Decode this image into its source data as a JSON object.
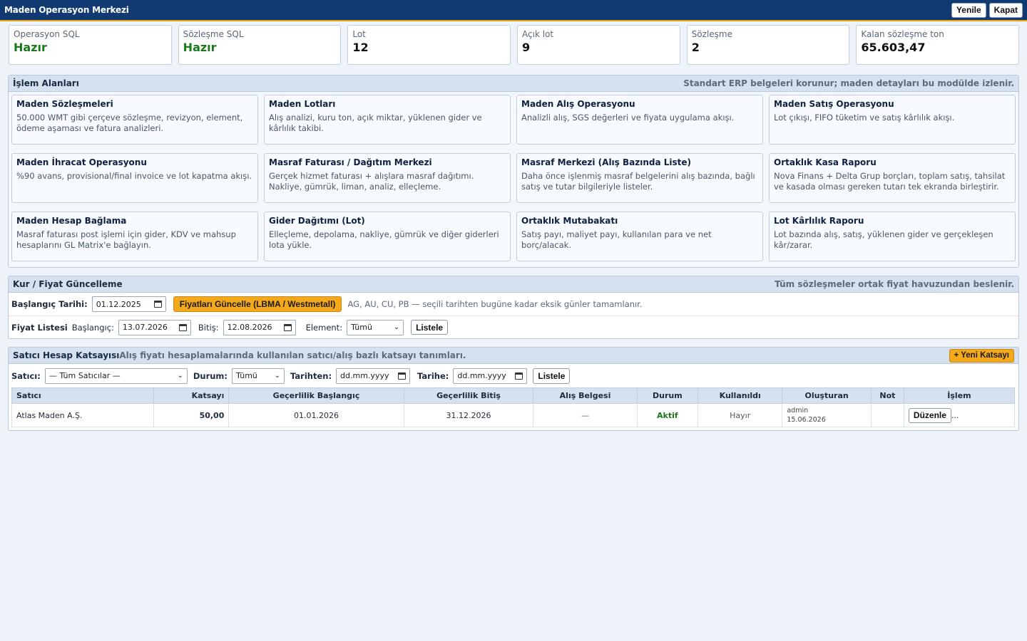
{
  "app": {
    "title": "Maden Operasyon Merkezi",
    "refresh": "Yenile",
    "close": "Kapat"
  },
  "stats": [
    {
      "label": "Operasyon SQL",
      "value": "Hazır",
      "status": "ok"
    },
    {
      "label": "Sözleşme SQL",
      "value": "Hazır",
      "status": "ok"
    },
    {
      "label": "Lot",
      "value": "12"
    },
    {
      "label": "Açık lot",
      "value": "9"
    },
    {
      "label": "Sözleşme",
      "value": "2"
    },
    {
      "label": "Kalan sözleşme ton",
      "value": "65.603,47"
    }
  ],
  "workspace": {
    "title": "İşlem Alanları",
    "note": "Standart ERP belgeleri korunur; maden detayları bu modülde izlenir.",
    "cards": [
      {
        "title": "Maden Sözleşmeleri",
        "desc": "50.000 WMT gibi çerçeve sözleşme, revizyon, element, ödeme aşaması ve fatura analizleri."
      },
      {
        "title": "Maden Lotları",
        "desc": "Alış analizi, kuru ton, açık miktar, yüklenen gider ve kârlılık takibi."
      },
      {
        "title": "Maden Alış Operasyonu",
        "desc": "Analizli alış, SGS değerleri ve fiyata uygulama akışı."
      },
      {
        "title": "Maden Satış Operasyonu",
        "desc": "Lot çıkışı, FIFO tüketim ve satış kârlılık akışı."
      },
      {
        "title": "Maden İhracat Operasyonu",
        "desc": "%90 avans, provisional/final invoice ve lot kapatma akışı."
      },
      {
        "title": "Masraf Faturası / Dağıtım Merkezi",
        "desc": "Gerçek hizmet faturası + alışlara masraf dağıtımı. Nakliye, gümrük, liman, analiz, elleçleme."
      },
      {
        "title": "Masraf Merkezi (Alış Bazında Liste)",
        "desc": "Daha önce işlenmiş masraf belgelerini alış bazında, bağlı satış ve tutar bilgileriyle listeler."
      },
      {
        "title": "Ortaklık Kasa Raporu",
        "desc": "Nova Finans + Delta Grup borçları, toplam satış, tahsilat ve kasada olması gereken tutarı tek ekranda birleştirir."
      },
      {
        "title": "Maden Hesap Bağlama",
        "desc": "Masraf faturası post işlemi için gider, KDV ve mahsup hesaplarını GL Matrix'e bağlayın."
      },
      {
        "title": "Gider Dağıtımı (Lot)",
        "desc": "Elleçleme, depolama, nakliye, gümrük ve diğer giderleri lota yükle."
      },
      {
        "title": "Ortaklık Mutabakatı",
        "desc": "Satış payı, maliyet payı, kullanılan para ve net borç/alacak."
      },
      {
        "title": "Lot Kârlılık Raporu",
        "desc": "Lot bazında alış, satış, yüklenen gider ve gerçekleşen kâr/zarar."
      }
    ]
  },
  "pricing": {
    "title": "Kur / Fiyat Güncelleme",
    "note": "Tüm sözleşmeler ortak fiyat havuzundan beslenir.",
    "start_label": "Başlangıç Tarihi:",
    "start_value": "01.12.2025",
    "update_button": "Fiyatları Güncelle (LBMA / Westmetall)",
    "update_hint": "AG, AU, CU, PB — seçili tarihten bugüne kadar eksik günler tamamlanır.",
    "list_title": "Fiyat Listesi",
    "list_start_label": "Başlangıç:",
    "list_start_value": "13.07.2026",
    "list_end_label": "Bitiş:",
    "list_end_value": "12.08.2026",
    "element_label": "Element:",
    "element_value": "Tümü",
    "list_button": "Listele"
  },
  "coeff": {
    "title": "Satıcı Hesap Katsayısı",
    "subtitle": "Alış fiyatı hesaplamalarında kullanılan satıcı/alış bazlı katsayı tanımları.",
    "new_button": "+ Yeni Katsayı",
    "filters": {
      "seller_label": "Satıcı:",
      "seller_value": "— Tüm Satıcılar —",
      "status_label": "Durum:",
      "status_value": "Tümü",
      "from_label": "Tarihten:",
      "from_placeholder": "dd.mm.yyyy",
      "to_label": "Tarihe:",
      "to_placeholder": "dd.mm.yyyy",
      "list_button": "Listele"
    },
    "columns": [
      "Satıcı",
      "Katsayı",
      "Geçerlilik Başlangıç",
      "Geçerlilik Bitiş",
      "Alış Belgesi",
      "Durum",
      "Kullanıldı",
      "Oluşturan",
      "Not",
      "İşlem"
    ],
    "rows": [
      {
        "seller": "Atlas Maden A.Ş.",
        "coefficient": "50,00",
        "valid_from": "01.01.2026",
        "valid_to": "31.12.2026",
        "purchase_doc": "—",
        "status": "Aktif",
        "used": "Hayır",
        "created_by": "admin",
        "created_at": "15.06.2026",
        "note": "",
        "edit_button": "Düzenle",
        "more": "..."
      }
    ]
  },
  "colors": {
    "header": "#123a72",
    "accent": "#f4a81b",
    "ok": "#1a7a1a",
    "panel_head": "#d5e1ef"
  }
}
